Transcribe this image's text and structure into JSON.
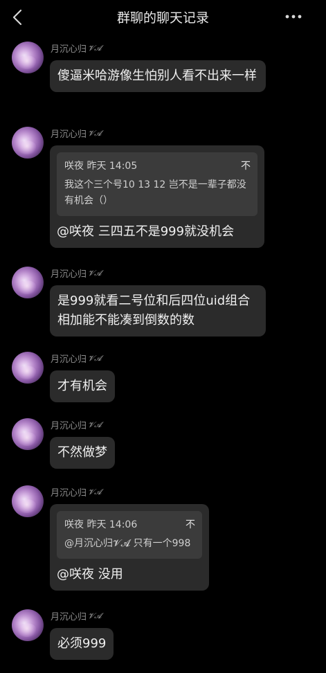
{
  "header": {
    "title": "群聊的聊天记录",
    "back_icon": "chevron-left-icon",
    "more_icon": "more-dots-icon"
  },
  "messages": [
    {
      "sender": "月沉心归",
      "badge": "𝓥𝓐",
      "text": "傻逼米哈游像生怕别人看不出来一样"
    },
    {
      "sender": "月沉心归",
      "badge": "𝓥𝓐",
      "quote": {
        "author_time": "咲夜 昨天 14:05",
        "tag": "不",
        "text": "我这个三个号10 13 12 岂不是一辈子都没有机会（）"
      },
      "text": "@咲夜 三四五不是999就没机会"
    },
    {
      "sender": "月沉心归",
      "badge": "𝓥𝓐",
      "text": "是999就看二号位和后四位uid组合相加能不能凑到倒数的数"
    },
    {
      "sender": "月沉心归",
      "badge": "𝓥𝓐",
      "text": "才有机会"
    },
    {
      "sender": "月沉心归",
      "badge": "𝓥𝓐",
      "text": "不然做梦"
    },
    {
      "sender": "月沉心归",
      "badge": "𝓥𝓐",
      "quote": {
        "author_time": "咲夜 昨天 14:06",
        "tag": "不",
        "text": "@月沉心归𝓥𝓐 只有一个998"
      },
      "text": "@咲夜 没用"
    },
    {
      "sender": "月沉心归",
      "badge": "𝓥𝓐",
      "text": "必须999"
    }
  ]
}
